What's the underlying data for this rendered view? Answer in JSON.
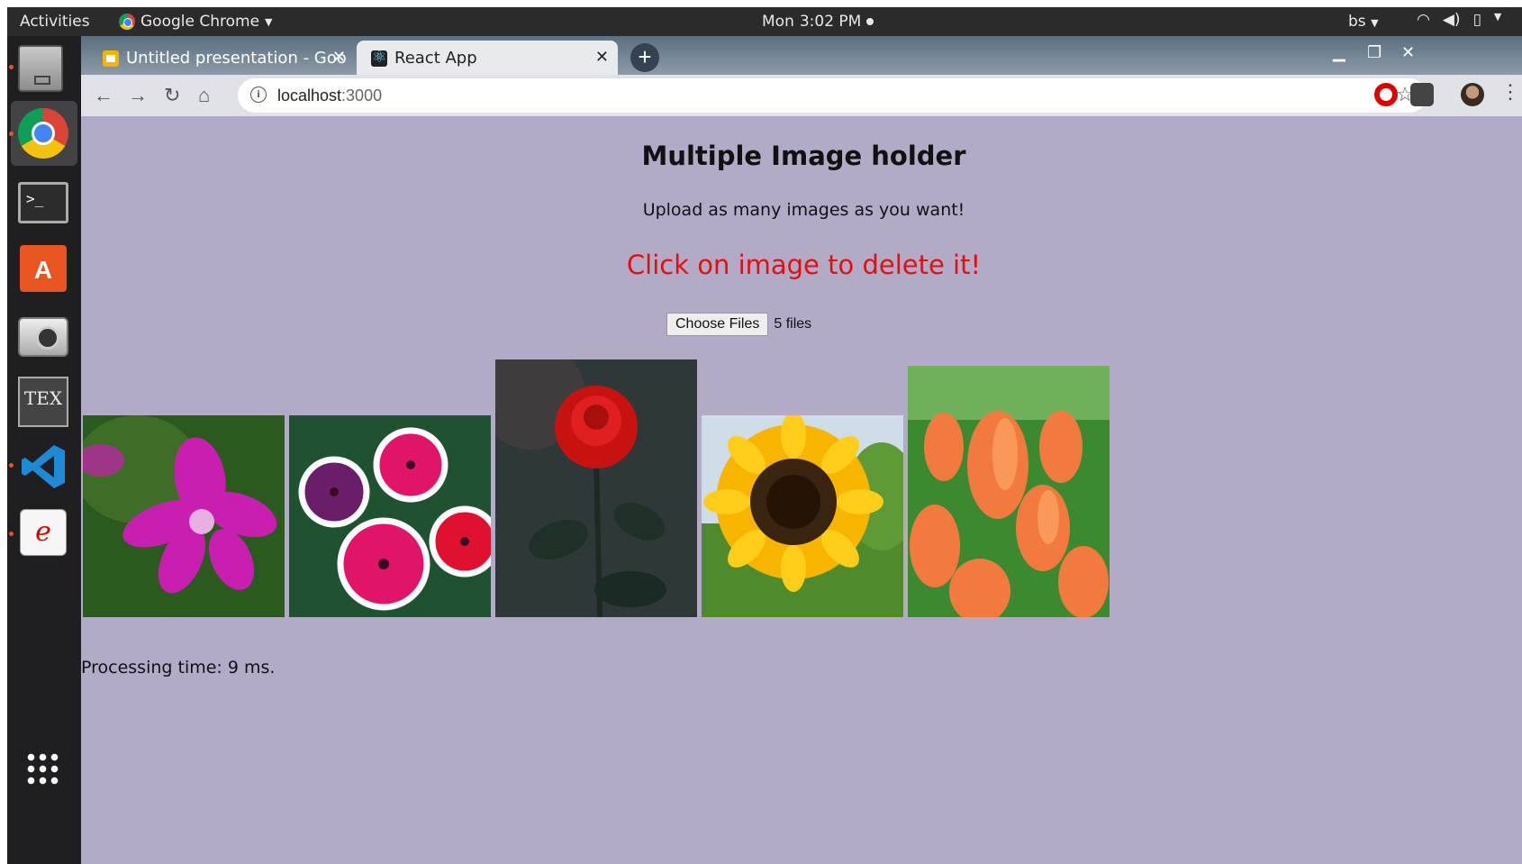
{
  "topbar": {
    "activities": "Activities",
    "app_name": "Google Chrome",
    "day": "Mon",
    "time": "3:02 PM",
    "user": "bs"
  },
  "dock": {
    "items": [
      "files-icon",
      "chrome-icon",
      "terminal-icon",
      "software-store-icon",
      "camera-icon",
      "texmaker-icon",
      "vscode-icon",
      "pdf-viewer-icon",
      "app-grid-icon"
    ],
    "terminal_glyph": ">_",
    "texmaker_label": "TEX"
  },
  "browser": {
    "tabs": [
      {
        "title": "Untitled presentation - Goo",
        "favicon": "slides-icon"
      },
      {
        "title": "React App",
        "favicon": "react-icon"
      }
    ],
    "url_host": "localhost",
    "url_port": ":3000"
  },
  "page": {
    "heading": "Multiple Image holder",
    "subtitle": "Upload as many images as you want!",
    "warning": "Click on image to delete it!",
    "file_button": "Choose Files",
    "file_status": "5 files",
    "images": [
      {
        "name": "orchid",
        "colors": [
          "#1f4a18",
          "#c91bb5"
        ]
      },
      {
        "name": "petunias",
        "colors": [
          "#1f5a2e",
          "#e0156a"
        ]
      },
      {
        "name": "red rose",
        "colors": [
          "#2a3233",
          "#d11515"
        ]
      },
      {
        "name": "sunflower",
        "colors": [
          "#c8d8e8",
          "#f7b500"
        ]
      },
      {
        "name": "tulips",
        "colors": [
          "#3b8a32",
          "#f27a3e"
        ]
      }
    ],
    "processing": "Processing time: 9 ms."
  },
  "colors": {
    "page_bg": "#b2aac6",
    "warning": "#e01010",
    "ubuntu_orange": "#e95420"
  }
}
